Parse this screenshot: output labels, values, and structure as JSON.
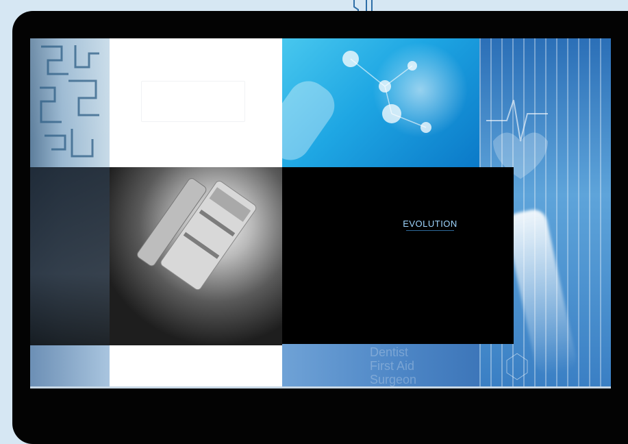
{
  "window": {
    "title": ""
  },
  "video": {
    "logo_text": "EVOLUTION",
    "faint_labels": [
      "Dentist",
      "First Aid",
      "Surgeon"
    ]
  },
  "colors": {
    "background": "#d6e7f3",
    "frame": "#030303",
    "accent_blue": "#1ea6e3",
    "logo_text": "#9fd6ff"
  },
  "icons": [
    "cable-icon",
    "microscope-image",
    "molecule-image",
    "maze-image"
  ]
}
